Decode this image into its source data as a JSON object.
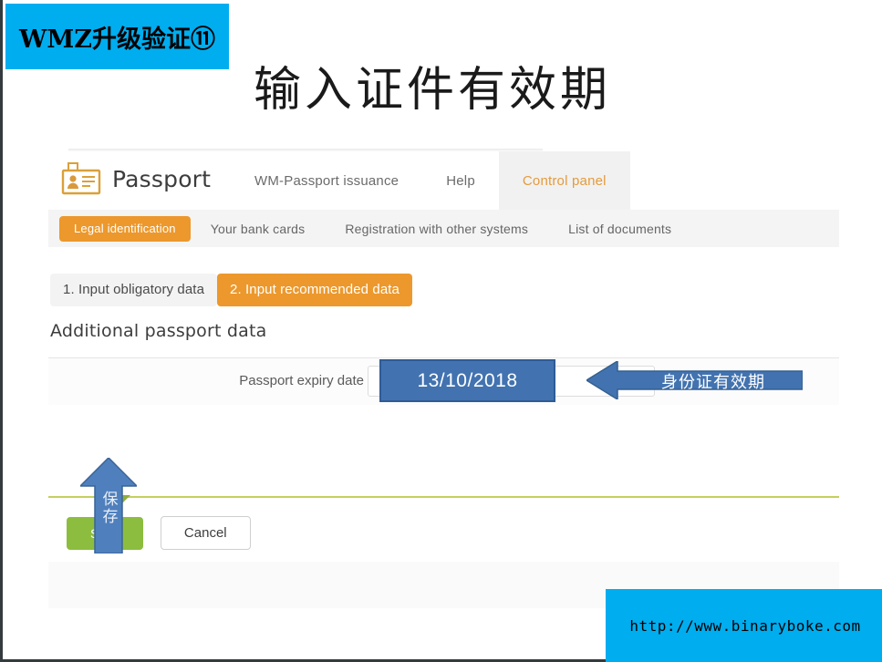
{
  "slide": {
    "badge_label": "WMZ升级验证⑪",
    "title": "输入证件有效期",
    "badge_color": "#00adef",
    "footer_url": "http://www.binaryboke.com"
  },
  "app": {
    "logo_text": "Passport",
    "logo_icon": "id-card-icon",
    "top_nav": [
      {
        "label": "WM-Passport issuance",
        "active": false
      },
      {
        "label": "Help",
        "active": false
      },
      {
        "label": "Control panel",
        "active": true
      }
    ],
    "sub_nav": {
      "pill": "Legal identification",
      "items": [
        "Your bank cards",
        "Registration with other systems",
        "List of documents"
      ]
    },
    "steps": [
      {
        "label": "1. Input obligatory data",
        "active": false
      },
      {
        "label": "2. Input recommended data",
        "active": true
      }
    ],
    "section_title": "Additional passport data",
    "form": {
      "field_label": "Passport expiry date",
      "field_value": "",
      "field_placeholder": ""
    },
    "buttons": {
      "save": "Save",
      "cancel": "Cancel",
      "save_color": "#8cbd3f",
      "accent_color": "#ec982c"
    }
  },
  "annotations": {
    "date_callout": "13/10/2018",
    "left_arrow_label": "身份证有效期",
    "up_arrow_label": "保存",
    "arrow_color": "#4273b0"
  }
}
